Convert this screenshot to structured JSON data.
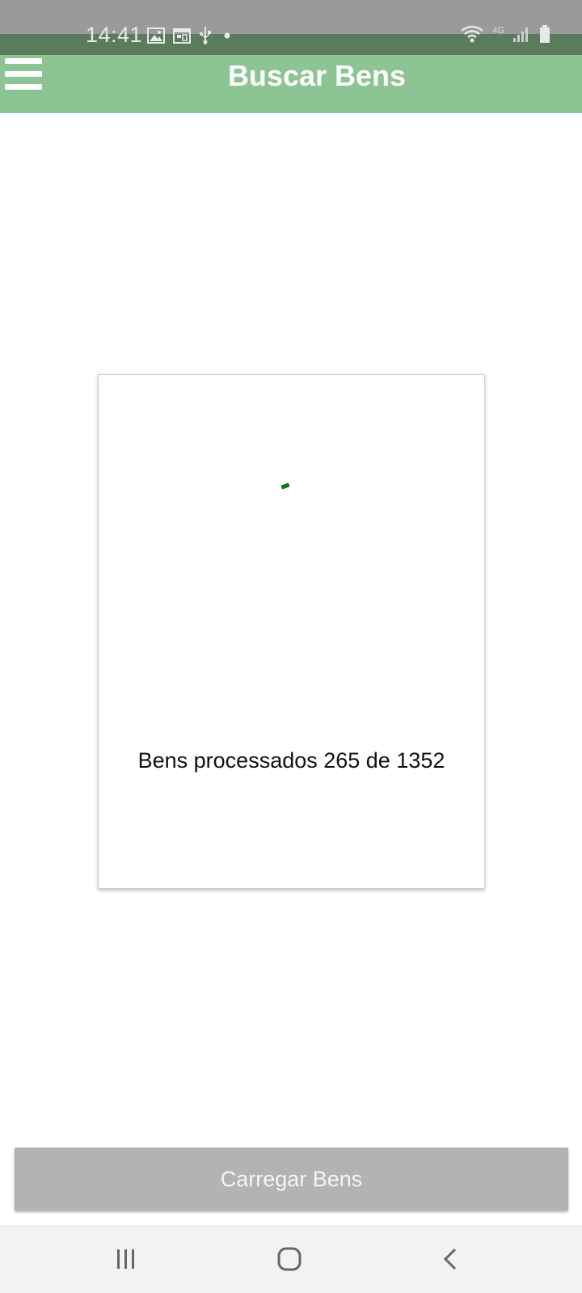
{
  "status_bar": {
    "time": "14:41",
    "network_label": "4G",
    "icons_left": [
      "image-icon",
      "calendar-icon",
      "usb-icon",
      "dot-icon"
    ],
    "icons_right": [
      "wifi-icon",
      "signal-icon",
      "battery-icon"
    ]
  },
  "toolbar": {
    "title": "Buscar Bens",
    "menu_icon": "hamburger-menu-icon",
    "background_color": "#8cc494"
  },
  "dialog": {
    "progress_text": "Bens processados 265 de 1352",
    "processed": 265,
    "total": 1352,
    "spinner_color": "#0a7a10"
  },
  "main": {
    "load_button_label": "Carregar Bens",
    "load_button_color": "#b3b3b3"
  },
  "navigation": {
    "items": [
      "recent-apps-icon",
      "home-icon",
      "back-icon"
    ]
  }
}
